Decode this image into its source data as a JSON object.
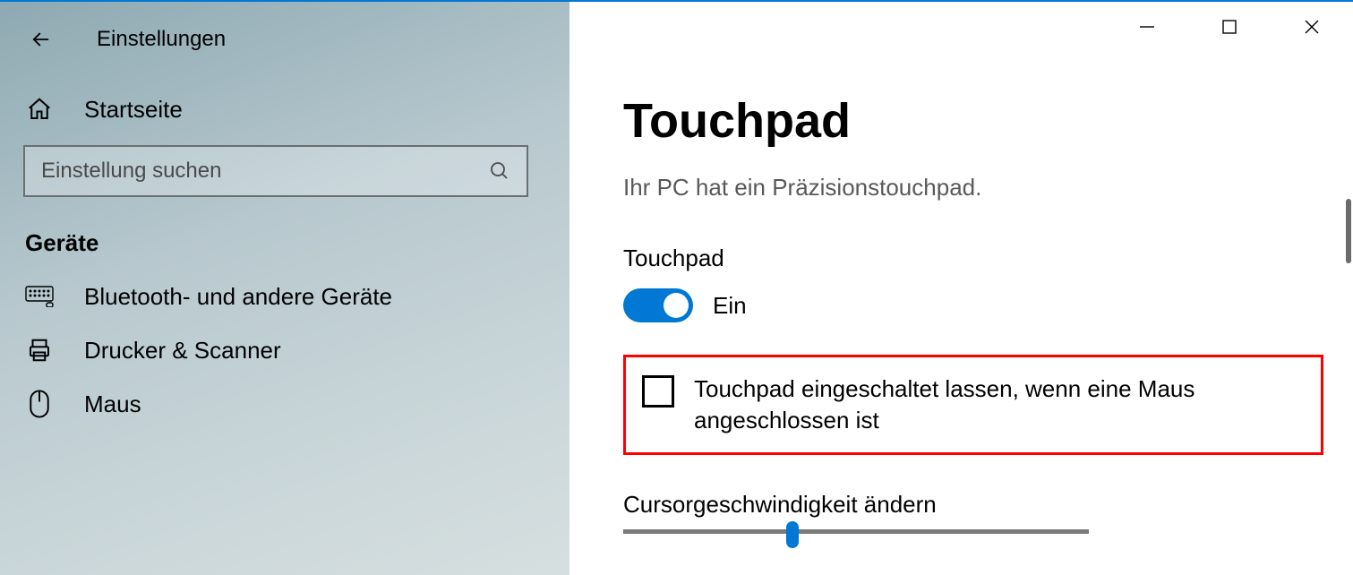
{
  "header": {
    "app_title": "Einstellungen"
  },
  "sidebar": {
    "home_label": "Startseite",
    "search_placeholder": "Einstellung suchen",
    "category_label": "Geräte",
    "items": [
      {
        "label": "Bluetooth- und andere Geräte"
      },
      {
        "label": "Drucker & Scanner"
      },
      {
        "label": "Maus"
      }
    ]
  },
  "main": {
    "title": "Touchpad",
    "subtitle": "Ihr PC hat ein Präzisionstouchpad.",
    "toggle_label": "Touchpad",
    "toggle_state": "Ein",
    "checkbox_label": "Touchpad eingeschaltet lassen, wenn eine Maus angeschlossen ist",
    "slider_label": "Cursorgeschwindigkeit ändern"
  }
}
